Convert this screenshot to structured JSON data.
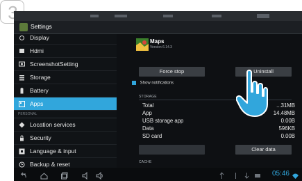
{
  "step_number": "3",
  "actionbar": {
    "title": "Settings"
  },
  "sidebar": {
    "items": [
      {
        "label": "Display",
        "icon": "display-icon"
      },
      {
        "label": "Hdmi",
        "icon": "hdmi-icon"
      },
      {
        "label": "ScreenshotSetting",
        "icon": "screenshot-icon"
      },
      {
        "label": "Storage",
        "icon": "storage-icon"
      },
      {
        "label": "Battery",
        "icon": "battery-icon"
      },
      {
        "label": "Apps",
        "icon": "apps-icon",
        "active": true
      }
    ],
    "header_personal": "PERSONAL",
    "items2": [
      {
        "label": "Location services",
        "icon": "location-icon"
      },
      {
        "label": "Security",
        "icon": "lock-icon"
      },
      {
        "label": "Language & input",
        "icon": "language-icon"
      },
      {
        "label": "Backup & reset",
        "icon": "backup-icon"
      }
    ]
  },
  "appinfo": {
    "name": "Maps",
    "version": "Version 6.14.3",
    "force_stop_label": "Force stop",
    "uninstall_label": "Uninstall",
    "show_notifications_label": "Show notifications",
    "storage_header": "STORAGE",
    "storage_rows": [
      {
        "label": "Total",
        "value": "...31MB"
      },
      {
        "label": "App",
        "value": "14.48MB"
      },
      {
        "label": "USB storage app",
        "value": "0.00B"
      },
      {
        "label": "Data",
        "value": "596KB"
      },
      {
        "label": "SD card",
        "value": "0.00B"
      }
    ],
    "clear_data_label": "Clear data",
    "cache_header": "CACHE"
  },
  "navbar": {
    "time": "05:46"
  },
  "colors": {
    "accent": "#31a6dc",
    "background": "#0e1013"
  }
}
